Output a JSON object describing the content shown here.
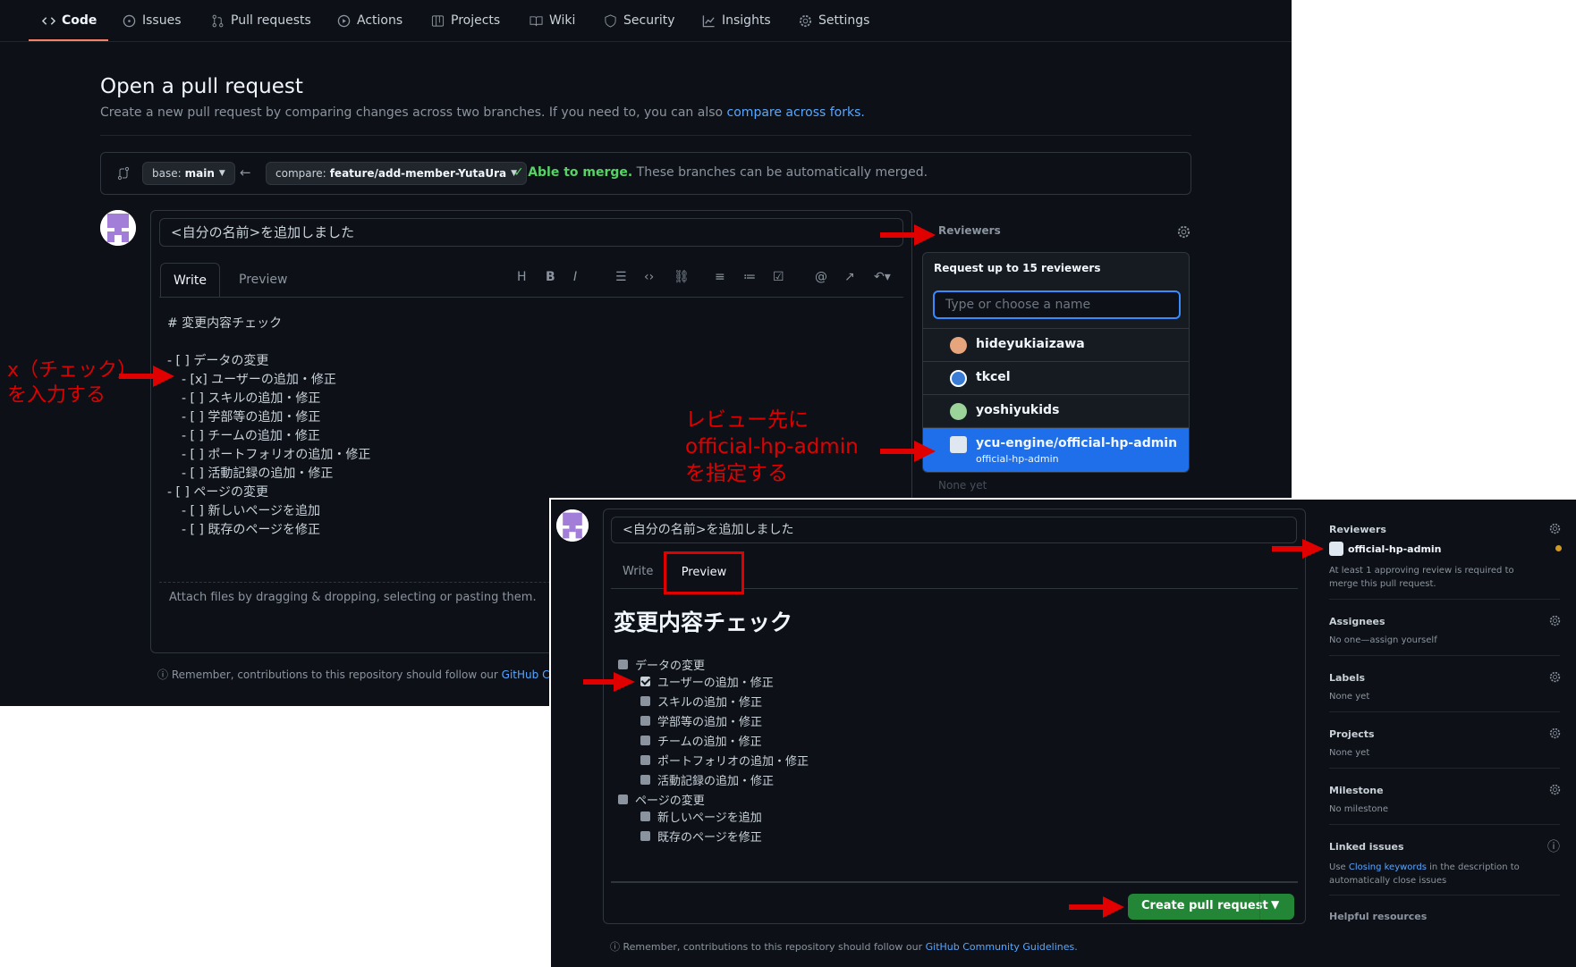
{
  "nav": {
    "items": [
      {
        "label": "Code",
        "icon": "code-icon"
      },
      {
        "label": "Issues",
        "icon": "issue-opened-icon"
      },
      {
        "label": "Pull requests",
        "icon": "git-pull-request-icon"
      },
      {
        "label": "Actions",
        "icon": "play-icon"
      },
      {
        "label": "Projects",
        "icon": "table-icon"
      },
      {
        "label": "Wiki",
        "icon": "book-icon"
      },
      {
        "label": "Security",
        "icon": "shield-icon"
      },
      {
        "label": "Insights",
        "icon": "graph-icon"
      },
      {
        "label": "Settings",
        "icon": "gear-icon"
      }
    ]
  },
  "header": {
    "title": "Open a pull request",
    "subtitle": "Create a new pull request by comparing changes across two branches. If you need to, you can also ",
    "subtitle_link": "compare across forks."
  },
  "range": {
    "base_prefix": "base:",
    "base_branch": "main",
    "compare_prefix": "compare:",
    "compare_branch": "feature/add-member-YutaUra",
    "merge_status": "Able to merge.",
    "merge_text": " These branches can be automatically merged."
  },
  "editor": {
    "title_value": "<自分の名前>を追加しました",
    "tab_write": "Write",
    "tab_preview": "Preview",
    "toolbar": [
      "H",
      "B",
      "I"
    ],
    "markdown_lines": [
      "# 変更内容チェック",
      "",
      "- [ ] データの変更",
      "  - [x] ユーザーの追加・修正",
      "  - [ ] スキルの追加・修正",
      "  - [ ] 学部等の追加・修正",
      "  - [ ] チームの追加・修正",
      "  - [ ] ポートフォリオの追加・修正",
      "  - [ ] 活動記録の追加・修正",
      "- [ ] ページの変更",
      "  - [ ] 新しいページを追加",
      "  - [ ] 既存のページを修正"
    ],
    "attach_hint": "Attach files by dragging & dropping, selecting or pasting them.",
    "remember": "Remember, contributions to this repository should follow our ",
    "remember_link": "GitHub Com"
  },
  "reviewers_dropdown": {
    "heading": "Reviewers",
    "title": "Request up to 15 reviewers",
    "placeholder": "Type or choose a name",
    "items": [
      {
        "name": "hideyukiaizawa"
      },
      {
        "name": "tkcel"
      },
      {
        "name": "yoshiyukids"
      },
      {
        "name": "ycu-engine/official-hp-admin",
        "sub": "official-hp-admin",
        "selected": true
      }
    ],
    "none_yet": "None yet"
  },
  "annotations": {
    "check_line1": "x（チェック）",
    "check_line2": "を入力する",
    "review_line1": "レビュー先に",
    "review_line2": "official-hp-admin",
    "review_line3": "を指定する",
    "color": "#e00000"
  },
  "preview_shot": {
    "title_value": "<自分の名前>を追加しました",
    "tab_write": "Write",
    "tab_preview": "Preview",
    "heading": "変更内容チェック",
    "items": [
      {
        "label": "データの変更",
        "level": 0,
        "checked": false
      },
      {
        "label": "ユーザーの追加・修正",
        "level": 1,
        "checked": true
      },
      {
        "label": "スキルの追加・修正",
        "level": 1,
        "checked": false
      },
      {
        "label": "学部等の追加・修正",
        "level": 1,
        "checked": false
      },
      {
        "label": "チームの追加・修正",
        "level": 1,
        "checked": false
      },
      {
        "label": "ポートフォリオの追加・修正",
        "level": 1,
        "checked": false
      },
      {
        "label": "活動記録の追加・修正",
        "level": 1,
        "checked": false
      },
      {
        "label": "ページの変更",
        "level": 0,
        "checked": false
      },
      {
        "label": "新しいページを追加",
        "level": 1,
        "checked": false
      },
      {
        "label": "既存のページを修正",
        "level": 1,
        "checked": false
      }
    ],
    "create_button": "Create pull request",
    "remember": "Remember, contributions to this repository should follow our ",
    "remember_link": "GitHub Community Guidelines",
    "sidebar": {
      "reviewers": {
        "heading": "Reviewers",
        "reviewer": "official-hp-admin",
        "note": "At least 1 approving review is required to merge this pull request."
      },
      "assignees": {
        "heading": "Assignees",
        "value": "No one—assign yourself"
      },
      "labels": {
        "heading": "Labels",
        "value": "None yet"
      },
      "projects": {
        "heading": "Projects",
        "value": "None yet"
      },
      "milestone": {
        "heading": "Milestone",
        "value": "No milestone"
      },
      "linked": {
        "heading": "Linked issues",
        "pre": "Use ",
        "link": "Closing keywords",
        "post": " in the description to automatically close issues"
      },
      "cut": "Helpful resources"
    }
  }
}
